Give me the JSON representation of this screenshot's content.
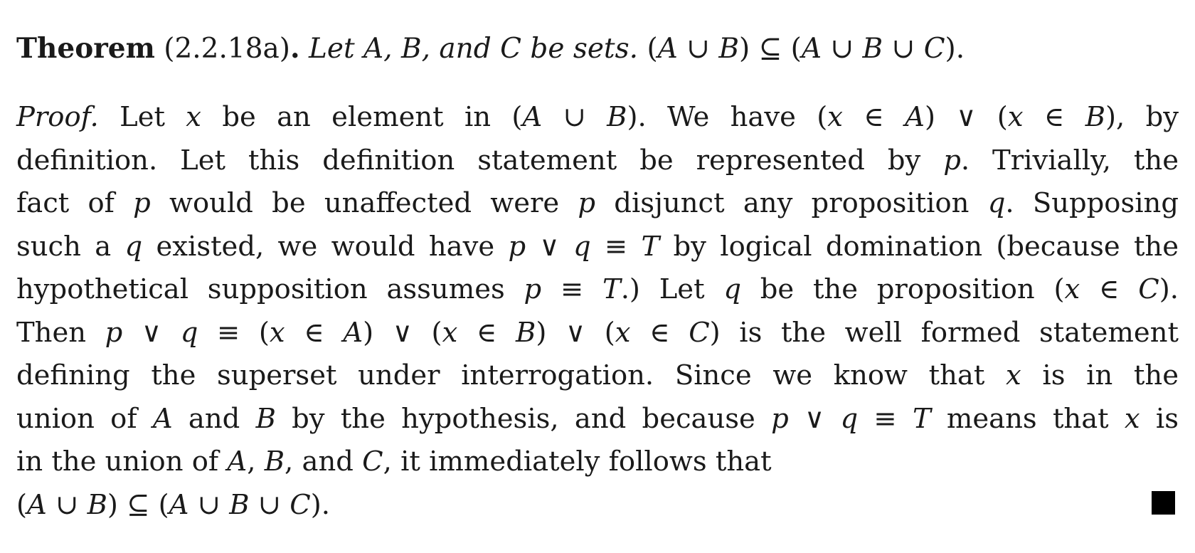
{
  "theorem": {
    "label": "Theorem",
    "number": "(2.2.18a)",
    "period": ".",
    "statement": "Let A, B, and C be sets.",
    "conclusion": "(A ∪ B) ⊆ (A ∪ B ∪ C)."
  },
  "proof": {
    "label": "Proof.",
    "lines": [
      "Let x be an element in (A ∪ B).  We have (x ∈ A) ∨ (x ∈ B), by",
      "definition. Let this definition statement be represented by p. Trivially, the",
      "fact of p would be unaffected were p disjunct any proposition q. Supposing",
      "such a q existed, we would have p ∨ q ≡ T by logical domination (because the",
      "hypothetical supposition assumes p ≡ T.) Let q be the proposition (x ∈ C).",
      "Then p ∨ q ≡ (x ∈ A) ∨ (x ∈ B) ∨ (x ∈ C) is the well formed statement",
      "defining the superset under interrogation. Since we know that x is in the",
      "union of A and B by the hypothesis, and because p ∨ q ≡ T means that x is",
      "in the union of A, B, and C, it immediately follows that",
      "(A ∪ B) ⊆ (A ∪ B ∪ C)."
    ]
  },
  "qed_symbol": "■"
}
